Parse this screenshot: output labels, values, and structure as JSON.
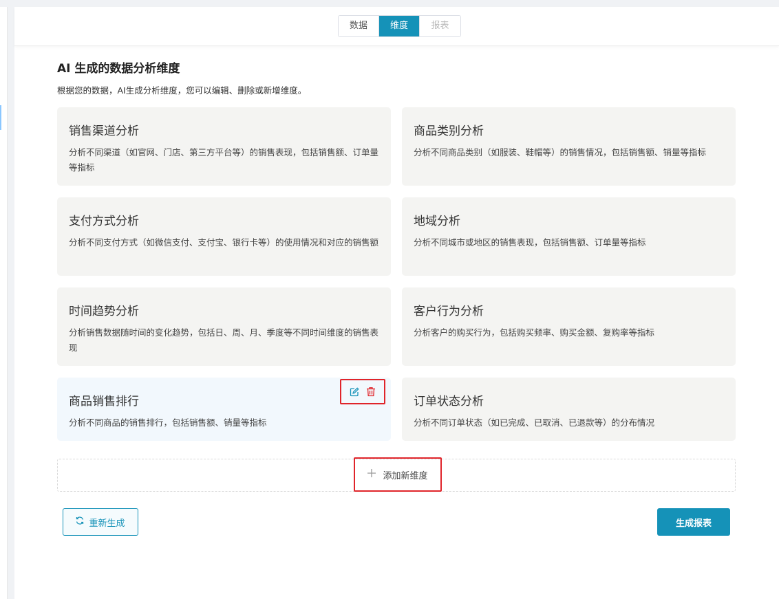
{
  "tabs": [
    {
      "label": "数据",
      "state": "normal"
    },
    {
      "label": "维度",
      "state": "active"
    },
    {
      "label": "报表",
      "state": "disabled"
    }
  ],
  "section": {
    "title": "AI 生成的数据分析维度",
    "description": "根据您的数据，AI生成分析维度，您可以编辑、删除或新增维度。"
  },
  "dimensions": [
    {
      "title": "销售渠道分析",
      "description": "分析不同渠道（如官网、门店、第三方平台等）的销售表现，包括销售额、订单量等指标"
    },
    {
      "title": "商品类别分析",
      "description": "分析不同商品类别（如服装、鞋帽等）的销售情况，包括销售额、销量等指标"
    },
    {
      "title": "支付方式分析",
      "description": "分析不同支付方式（如微信支付、支付宝、银行卡等）的使用情况和对应的销售额"
    },
    {
      "title": "地域分析",
      "description": "分析不同城市或地区的销售表现，包括销售额、订单量等指标"
    },
    {
      "title": "时间趋势分析",
      "description": "分析销售数据随时间的变化趋势，包括日、周、月、季度等不同时间维度的销售表现"
    },
    {
      "title": "客户行为分析",
      "description": "分析客户的购买行为，包括购买频率、购买金额、复购率等指标"
    },
    {
      "title": "商品销售排行",
      "description": "分析不同商品的销售排行，包括销售额、销量等指标"
    },
    {
      "title": "订单状态分析",
      "description": "分析不同订单状态（如已完成、已取消、已退款等）的分布情况"
    }
  ],
  "actions": {
    "add_label": "添加新维度",
    "regenerate_label": "重新生成",
    "generate_label": "生成报表"
  },
  "colors": {
    "primary": "#1592b8",
    "highlight_box": "#e0242a",
    "delete_icon": "#e0242a"
  }
}
